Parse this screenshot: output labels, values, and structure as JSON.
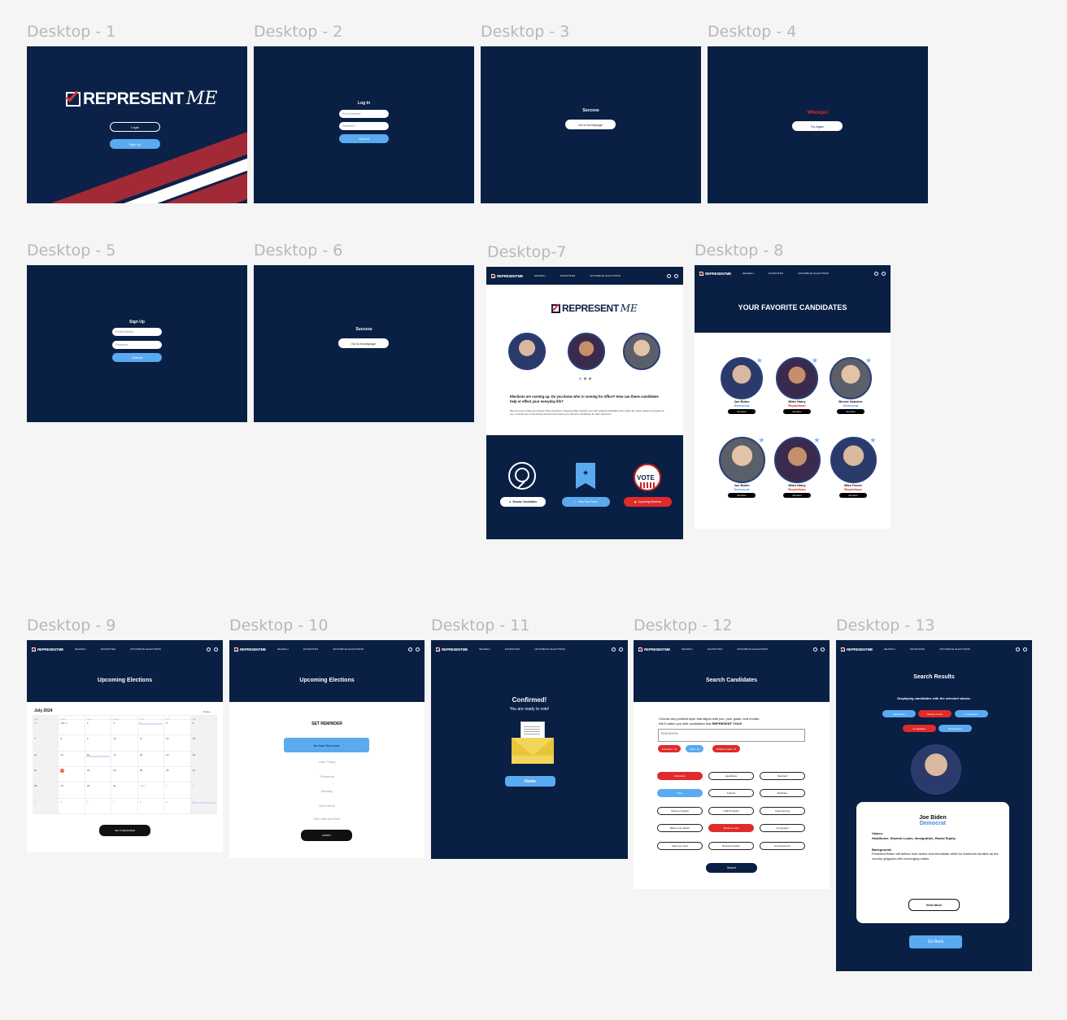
{
  "frames": {
    "d1": {
      "label": "Desktop - 1",
      "logo_main": "REPRESENT",
      "logo_script": "ME",
      "login": "Login",
      "signup": "Sign Up"
    },
    "d2": {
      "label": "Desktop - 2",
      "title": "Log In",
      "email_ph": "Email Address",
      "password_ph": "Password",
      "submit": "Submit"
    },
    "d3": {
      "label": "Desktop - 3",
      "title": "Success",
      "button": "Go to homepage"
    },
    "d4": {
      "label": "Desktop - 4",
      "title": "Whoops!",
      "button": "Try Again"
    },
    "d5": {
      "label": "Desktop - 5",
      "title": "Sign Up",
      "email_ph": "Email Address",
      "password_ph": "Password",
      "submit": "Submit"
    },
    "d6": {
      "label": "Desktop - 6",
      "title": "Success",
      "button": "Go to homepage"
    },
    "d7": {
      "label": "Desktop-7",
      "headline": "Elections are coming up. Do you know who is running for office? How can these candidates help or effect your everyday life?",
      "body": "We are here to help you answer these questions. RepresentMe matches you with political candidates who share the same values and goals as you, reminds you of upcoming elections and saves your favorite candidates for later reference.",
      "browse": "Browse Candidates",
      "faves": "View Your Faves",
      "upcoming": "Upcoming Elections",
      "vote": "VOTE"
    },
    "d8": {
      "label": "Desktop - 8",
      "banner": "YOUR FAVORITE CANDIDATES",
      "view_more": "View More",
      "candidates": [
        {
          "name": "Joe Biden",
          "party": "Democrat"
        },
        {
          "name": "Nikki Haley",
          "party": "Republican"
        },
        {
          "name": "Bernie Sanders",
          "party": "Democrat"
        },
        {
          "name": "Joe Biden",
          "party": "Democrat"
        },
        {
          "name": "Nikki Haley",
          "party": "Republican"
        },
        {
          "name": "Mike Pence",
          "party": "Republican"
        }
      ]
    },
    "d9": {
      "label": "Desktop - 9",
      "banner": "Upcoming  Elections",
      "month": "July 2024",
      "today": "Today",
      "days": [
        "Sun",
        "Mon",
        "Tue",
        "Wed",
        "Thu",
        "Fri",
        "Sat"
      ],
      "button": "SET A REMINDER"
    },
    "d10": {
      "label": "Desktop - 10",
      "banner": "Upcoming  Elections",
      "title": "SET REMINDER",
      "options": [
        "An hour from now",
        "Later Today",
        "Tomorrow",
        "Monday",
        "Next Week",
        "Pick date and time"
      ],
      "submit": "SUBMIT"
    },
    "d11": {
      "label": "Desktop - 11",
      "title": "Confirmed!",
      "subtitle": "You are ready to vote!",
      "button": "Home"
    },
    "d12": {
      "label": "Desktop - 12",
      "banner": "Search Candidates",
      "intro_a": "Choose any political topic that aligns with you, your goals, and morals.",
      "intro_b": "We'll match you with candidates that",
      "intro_c": "REPRESENT YOU!!",
      "query": "EDUCATION",
      "chips": [
        "Education",
        "State",
        "Student Loans"
      ],
      "topics": [
        "Education",
        "Healthcare",
        "Medicaid",
        "State",
        "Federal",
        "Medicare",
        "Women's Rights",
        "LGBTQ Rights",
        "Clean Energy",
        "Black Lives Matter",
        "Student Loans",
        "Immigration",
        "Supreme Court",
        "Business Rights",
        "Homelessness"
      ],
      "search": "Search"
    },
    "d13": {
      "label": "Desktop - 13",
      "title": "Search Results",
      "subtitle": "Displaying candidates with the selected values:",
      "chips": [
        "Healthcare",
        "Student Loans",
        "Immigration",
        "Immigration",
        "Racial Equity"
      ],
      "name": "Joe Biden",
      "party": "Democrat",
      "values_label": "Values:",
      "values": "Healthcare, Student Loans, Immigration, Racial Equity",
      "background_label": "Background:",
      "background": "President Biden will deliver bold action and immediate relief for American families as the country grapples with converging crises.",
      "view_more": "View More",
      "go_back": "Go Back"
    }
  },
  "nav": {
    "brand": "REPRESENTME",
    "search": "SEARCH",
    "favorites": "FAVORITES",
    "upcoming": "UPCOMING ELECTIONS"
  },
  "colors": {
    "navy": "#0a1f44",
    "blue": "#5aaaf0",
    "red": "#e12a2a",
    "canvas": "#f5f5f5"
  }
}
